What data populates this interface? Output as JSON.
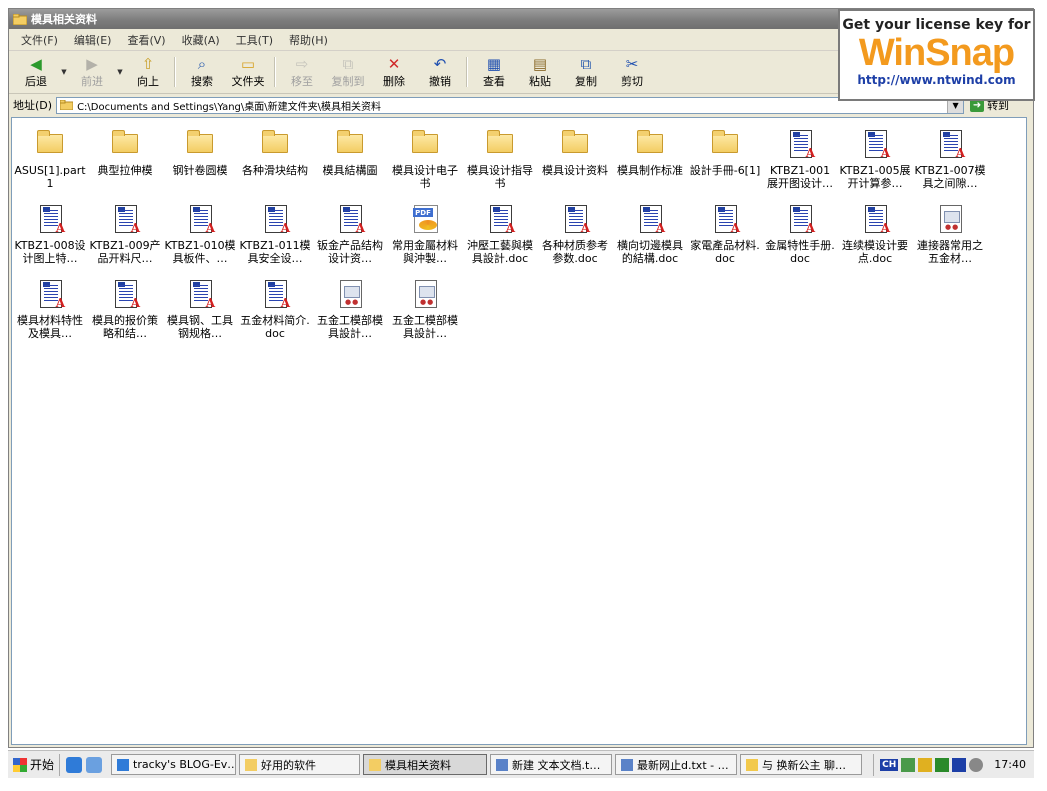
{
  "window": {
    "title": "模具相关资料"
  },
  "menu": [
    "文件(F)",
    "编辑(E)",
    "查看(V)",
    "收藏(A)",
    "工具(T)",
    "帮助(H)"
  ],
  "toolbar": {
    "back": "后退",
    "forward": "前进",
    "up": "向上",
    "search": "搜索",
    "folders": "文件夹",
    "move_to": "移至",
    "copy_to": "复制到",
    "delete": "删除",
    "undo": "撤销",
    "views": "查看",
    "paste": "粘贴",
    "copy": "复制",
    "cut": "剪切"
  },
  "address": {
    "label": "地址(D)",
    "path": "C:\\Documents and Settings\\Yang\\桌面\\新建文件夹\\模具相关资料",
    "go": "转到"
  },
  "files": [
    {
      "name": "ASUS[1].part1",
      "kind": "folder"
    },
    {
      "name": "典型拉伸模",
      "kind": "folder"
    },
    {
      "name": "钢针卷圆模",
      "kind": "folder"
    },
    {
      "name": "各种滑块结构",
      "kind": "folder"
    },
    {
      "name": "模具結構圖",
      "kind": "folder"
    },
    {
      "name": "模具设计电子书",
      "kind": "folder"
    },
    {
      "name": "模具设计指导书",
      "kind": "folder"
    },
    {
      "name": "模具设计资料",
      "kind": "folder"
    },
    {
      "name": "模具制作标准",
      "kind": "folder"
    },
    {
      "name": "設計手冊-6[1]",
      "kind": "folder"
    },
    {
      "name": "KTBZ1-001 展开图设计…",
      "kind": "doc"
    },
    {
      "name": "KTBZ1-005展开计算参…",
      "kind": "doc"
    },
    {
      "name": "KTBZ1-007模具之间隙…",
      "kind": "doc"
    },
    {
      "name": "KTBZ1-008设计图上特…",
      "kind": "doc"
    },
    {
      "name": "KTBZ1-009产品开料尺…",
      "kind": "doc"
    },
    {
      "name": "KTBZ1-010模具板件、…",
      "kind": "doc"
    },
    {
      "name": "KTBZ1-011模具安全设…",
      "kind": "doc"
    },
    {
      "name": "钣金产品结构设计资…",
      "kind": "doc"
    },
    {
      "name": "常用金屬材料與沖製…",
      "kind": "pdf"
    },
    {
      "name": "沖壓工藝與模具設計.doc",
      "kind": "doc"
    },
    {
      "name": "各种材质参考参数.doc",
      "kind": "doc"
    },
    {
      "name": "横向切邊模具的結構.doc",
      "kind": "doc"
    },
    {
      "name": "家電產品材料.doc",
      "kind": "doc"
    },
    {
      "name": "金属特性手册.doc",
      "kind": "doc"
    },
    {
      "name": "连续模设计要点.doc",
      "kind": "doc"
    },
    {
      "name": "連接器常用之五金材…",
      "kind": "generic"
    },
    {
      "name": "模具材料特性及模具…",
      "kind": "doc"
    },
    {
      "name": "模具的报价策略和结…",
      "kind": "doc"
    },
    {
      "name": "模具钢、工具钢规格…",
      "kind": "doc"
    },
    {
      "name": "五金材料简介.doc",
      "kind": "doc"
    },
    {
      "name": "五金工模部模具設計…",
      "kind": "generic"
    },
    {
      "name": "五金工模部模具設計…",
      "kind": "generic"
    }
  ],
  "banner": {
    "line1": "Get your license key for",
    "brand": "WinSnap",
    "url": "http://www.ntwind.com"
  },
  "taskbar": {
    "start": "开始",
    "tasks": [
      {
        "label": "tracky's BLOG-Ev…",
        "icon": "ie"
      },
      {
        "label": "好用的软件",
        "icon": "folder"
      },
      {
        "label": "模具相关资料",
        "icon": "folder",
        "active": true
      },
      {
        "label": "新建 文本文档.t…",
        "icon": "notepad"
      },
      {
        "label": "最新网止d.txt - …",
        "icon": "notepad"
      },
      {
        "label": "与 换新公主 聊…",
        "icon": "chat"
      }
    ],
    "lang": "CH",
    "clock": "17:40"
  }
}
